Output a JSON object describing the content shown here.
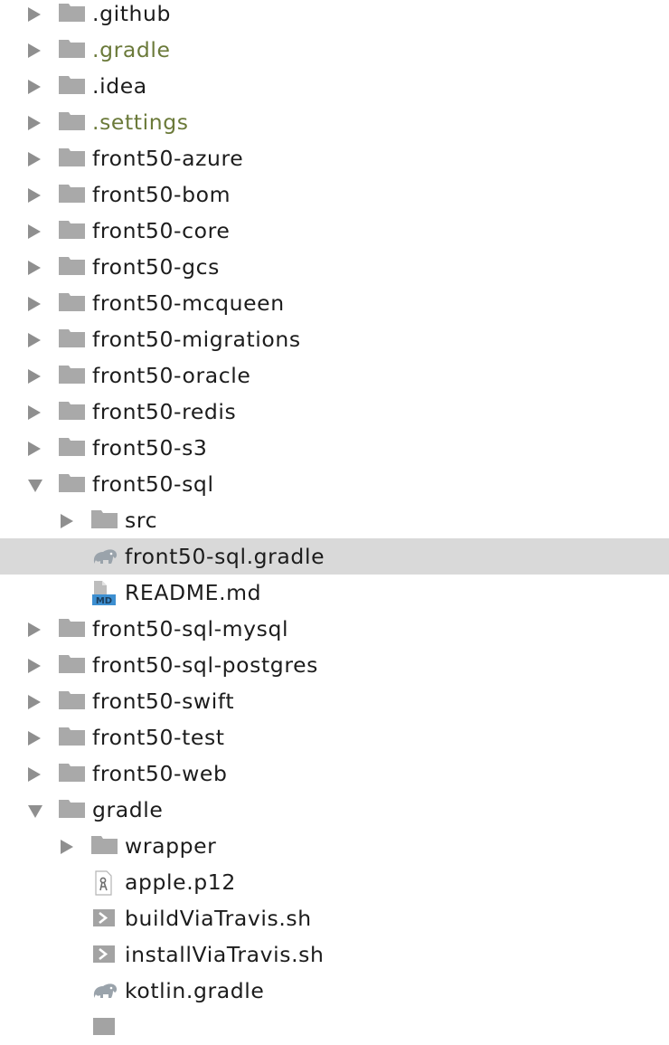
{
  "tree": {
    "items": [
      {
        "label": ".github",
        "icon": "folder-icon",
        "level": 0,
        "expand": "collapsed",
        "ignored": false
      },
      {
        "label": ".gradle",
        "icon": "folder-icon",
        "level": 0,
        "expand": "collapsed",
        "ignored": true
      },
      {
        "label": ".idea",
        "icon": "folder-icon",
        "level": 0,
        "expand": "collapsed",
        "ignored": false
      },
      {
        "label": ".settings",
        "icon": "folder-icon",
        "level": 0,
        "expand": "collapsed",
        "ignored": true
      },
      {
        "label": "front50-azure",
        "icon": "folder-icon",
        "level": 0,
        "expand": "collapsed",
        "ignored": false
      },
      {
        "label": "front50-bom",
        "icon": "folder-icon",
        "level": 0,
        "expand": "collapsed",
        "ignored": false
      },
      {
        "label": "front50-core",
        "icon": "folder-icon",
        "level": 0,
        "expand": "collapsed",
        "ignored": false
      },
      {
        "label": "front50-gcs",
        "icon": "folder-icon",
        "level": 0,
        "expand": "collapsed",
        "ignored": false
      },
      {
        "label": "front50-mcqueen",
        "icon": "folder-icon",
        "level": 0,
        "expand": "collapsed",
        "ignored": false
      },
      {
        "label": "front50-migrations",
        "icon": "folder-icon",
        "level": 0,
        "expand": "collapsed",
        "ignored": false
      },
      {
        "label": "front50-oracle",
        "icon": "folder-icon",
        "level": 0,
        "expand": "collapsed",
        "ignored": false
      },
      {
        "label": "front50-redis",
        "icon": "folder-icon",
        "level": 0,
        "expand": "collapsed",
        "ignored": false
      },
      {
        "label": "front50-s3",
        "icon": "folder-icon",
        "level": 0,
        "expand": "collapsed",
        "ignored": false
      },
      {
        "label": "front50-sql",
        "icon": "folder-icon",
        "level": 0,
        "expand": "expanded",
        "ignored": false
      },
      {
        "label": "src",
        "icon": "folder-icon",
        "level": 1,
        "expand": "collapsed",
        "ignored": false
      },
      {
        "label": "front50-sql.gradle",
        "icon": "gradle-elephant-icon",
        "level": 1,
        "expand": "none",
        "ignored": false,
        "selected": true
      },
      {
        "label": "README.md",
        "icon": "markdown-file-icon",
        "level": 1,
        "expand": "none",
        "ignored": false
      },
      {
        "label": "front50-sql-mysql",
        "icon": "folder-icon",
        "level": 0,
        "expand": "collapsed",
        "ignored": false
      },
      {
        "label": "front50-sql-postgres",
        "icon": "folder-icon",
        "level": 0,
        "expand": "collapsed",
        "ignored": false
      },
      {
        "label": "front50-swift",
        "icon": "folder-icon",
        "level": 0,
        "expand": "collapsed",
        "ignored": false
      },
      {
        "label": "front50-test",
        "icon": "folder-icon",
        "level": 0,
        "expand": "collapsed",
        "ignored": false
      },
      {
        "label": "front50-web",
        "icon": "folder-icon",
        "level": 0,
        "expand": "collapsed",
        "ignored": false
      },
      {
        "label": "gradle",
        "icon": "folder-icon",
        "level": 0,
        "expand": "expanded",
        "ignored": false
      },
      {
        "label": "wrapper",
        "icon": "folder-icon",
        "level": 1,
        "expand": "collapsed",
        "ignored": false
      },
      {
        "label": "apple.p12",
        "icon": "certificate-file-icon",
        "level": 1,
        "expand": "none",
        "ignored": false
      },
      {
        "label": "buildViaTravis.sh",
        "icon": "shell-script-icon",
        "level": 1,
        "expand": "none",
        "ignored": false
      },
      {
        "label": "installViaTravis.sh",
        "icon": "shell-script-icon",
        "level": 1,
        "expand": "none",
        "ignored": false
      },
      {
        "label": "kotlin.gradle",
        "icon": "gradle-elephant-icon",
        "level": 1,
        "expand": "none",
        "ignored": false
      }
    ]
  },
  "colors": {
    "text": "#1c1c1c",
    "ignored_text": "#6b7a3a",
    "folder": "#a9a9a9",
    "arrow": "#8f8f8f",
    "selection": "#d9d9d9",
    "markdown_badge": "#3d8fd1"
  }
}
